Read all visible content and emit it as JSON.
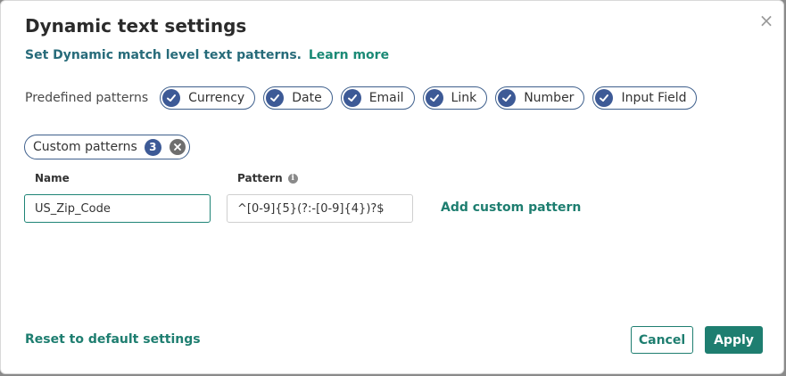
{
  "dialog": {
    "title": "Dynamic text settings",
    "subtitle": "Set Dynamic match level text patterns.",
    "learn_more": "Learn more",
    "close_glyph": "×"
  },
  "predefined": {
    "label": "Predefined patterns",
    "items": [
      {
        "label": "Currency",
        "checked": true
      },
      {
        "label": "Date",
        "checked": true
      },
      {
        "label": "Email",
        "checked": true
      },
      {
        "label": "Link",
        "checked": true
      },
      {
        "label": "Number",
        "checked": true
      },
      {
        "label": "Input Field",
        "checked": true
      }
    ]
  },
  "custom": {
    "label": "Custom patterns",
    "count": "3"
  },
  "form": {
    "name_label": "Name",
    "pattern_label": "Pattern",
    "name_value": "US_Zip_Code",
    "pattern_value": "^[0-9]{5}(?:-[0-9]{4})?$",
    "add_label": "Add custom pattern"
  },
  "footer": {
    "reset_label": "Reset to default settings",
    "cancel_label": "Cancel",
    "apply_label": "Apply"
  },
  "colors": {
    "accent_teal": "#1e7e70",
    "chip_blue": "#3d5a96"
  },
  "icons": {
    "close": "close-icon",
    "check": "check-circle-icon",
    "remove": "remove-circle-icon",
    "info": "info-icon"
  }
}
